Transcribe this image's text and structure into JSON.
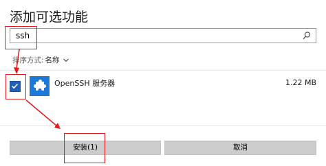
{
  "dialog": {
    "title": "添加可选功能"
  },
  "search": {
    "value": "ssh"
  },
  "sort": {
    "prefix": "排序方式:",
    "value": "名称"
  },
  "features": [
    {
      "name": "OpenSSH 服务器",
      "size": "1.22 MB",
      "checked": true
    }
  ],
  "buttons": {
    "install_label": "安装(1)",
    "cancel_label": "取消"
  },
  "colors": {
    "accent": "#1f5fb4",
    "feature_icon_bg": "#1e78d6",
    "button_bg": "#cccccc",
    "annotation": "#e0191d"
  },
  "icons": {
    "search": "search-icon",
    "sort": "chevron-down-icon",
    "feature": "puzzle-icon",
    "checkbox": "checkmark-icon"
  }
}
